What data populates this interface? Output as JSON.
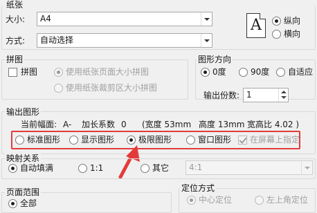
{
  "paper": {
    "title": "纸张",
    "size_label": "大小:",
    "size_value": "A4",
    "method_label": "方式:",
    "method_value": "自动选择",
    "page_icon_glyph": "A",
    "orientation_portrait": "纵向",
    "orientation_landscape": "横向"
  },
  "tile": {
    "title": "拼图",
    "checkbox_label": "拼图",
    "option_page_size": "使用纸张页面大小拼图",
    "option_crop_size": "使用纸张裁剪区大小拼图"
  },
  "direction": {
    "title": "图形方向",
    "opt_0": "0度",
    "opt_90": "90度",
    "opt_auto": "自适应",
    "copies_label": "输出份数:",
    "copies_value": "1"
  },
  "output": {
    "title": "输出图形",
    "current_label": "当前幅面:",
    "current_value": "A-",
    "factor_label": "加长系数",
    "factor_value": "0",
    "width_text": "(宽度 53mm",
    "height_text": "高度 13mm",
    "ratio_text": "宽高比 4.02 )",
    "opt_standard": "标准图形",
    "opt_display": "显示图形",
    "opt_limit": "极限图形",
    "opt_window": "窗口图形",
    "opt_screen": "在屏幕上指定"
  },
  "mapping": {
    "title": "映射关系",
    "opt_autofill": "自动填满",
    "opt_1to1": "1:1",
    "opt_other": "其它",
    "ratio_value": "4:1"
  },
  "page_range": {
    "title": "页面范围",
    "opt_all": "全部"
  },
  "position": {
    "title": "定位方式",
    "opt_center": "中心定位",
    "opt_topleft": "左上角定位"
  },
  "colors": {
    "highlight": "#e33b3b",
    "arrow": "#e33b3b"
  }
}
